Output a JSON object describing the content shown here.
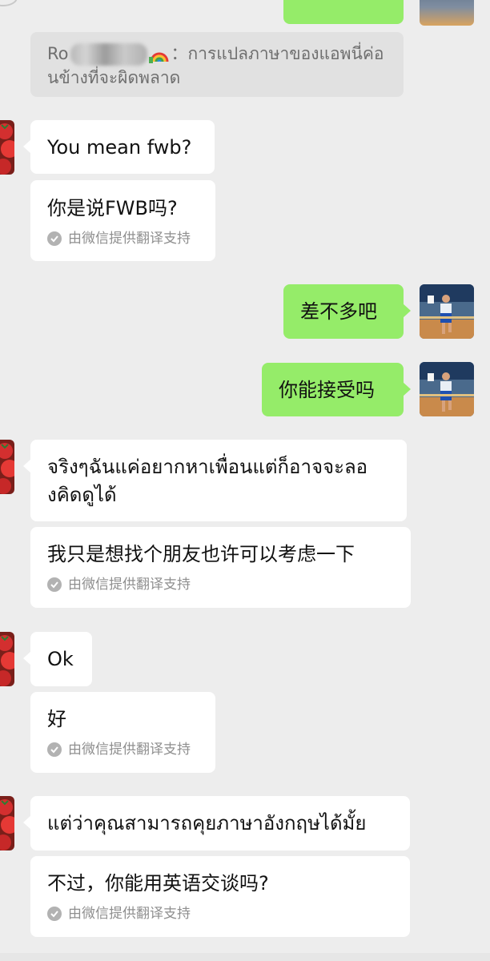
{
  "quote": {
    "name_prefix": "Ro",
    "separator": "：",
    "text_line1": "การแปลภาษาของแอพนี่ค่อ",
    "text_line2": "นข้างที่จะผิดพลาด"
  },
  "translation_note": "由微信提供翻译支持",
  "messages": [
    {
      "side": "left",
      "text": "You mean fwb?",
      "translation": "你是说FWB吗?"
    },
    {
      "side": "right",
      "text": "差不多吧"
    },
    {
      "side": "right",
      "text": "你能接受吗"
    },
    {
      "side": "left",
      "text_line1": "จริงๆฉันแค่อยากหาเพื่อนแต่ก็อาจจะลอ",
      "text_line2": "งคิดดูได้",
      "translation": "我只是想找个朋友也许可以考虑一下"
    },
    {
      "side": "left",
      "text": "Ok",
      "translation": "好"
    },
    {
      "side": "left",
      "text": "แต่ว่าคุณสามารถคุยภาษาอังกฤษได้มั้ย",
      "translation": "不过，你能用英语交谈吗?"
    }
  ],
  "colors": {
    "background": "#ededed",
    "bubble_sent": "#95ec69",
    "bubble_received": "#ffffff",
    "quote_bg": "#e1e1e1",
    "note_text": "#8f8f8f"
  },
  "icons": [
    "check-circle-icon",
    "tomato-avatar",
    "basketball-avatar",
    "rainbow-emoji"
  ]
}
